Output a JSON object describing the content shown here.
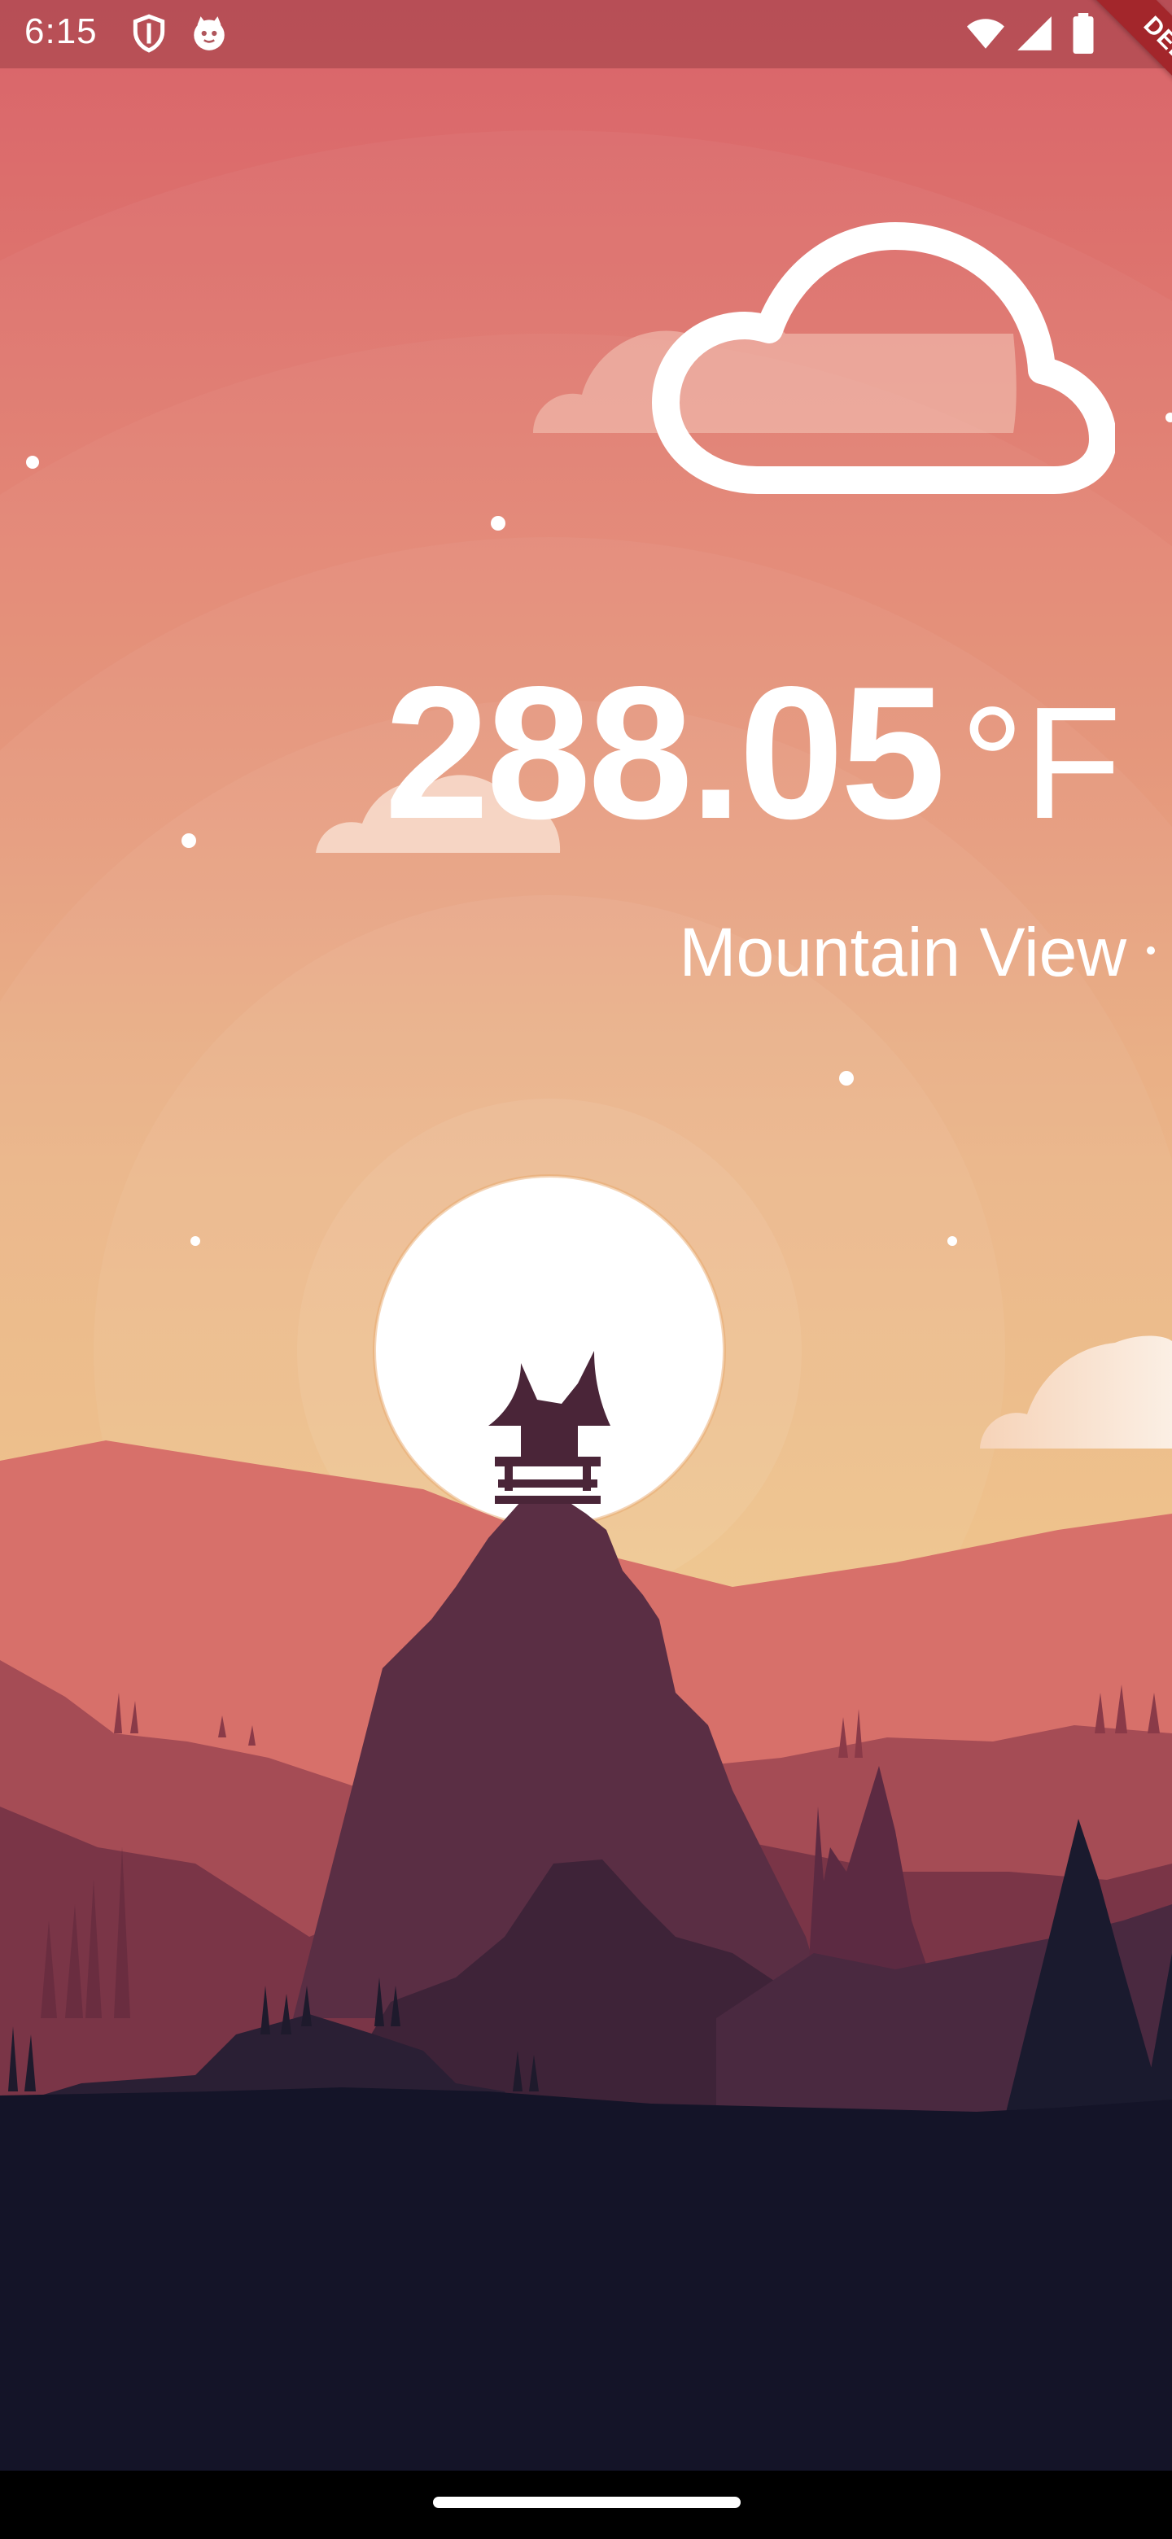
{
  "status_bar": {
    "time": "6:15",
    "icons": [
      "shield-icon",
      "cat-icon",
      "wifi-icon",
      "signal-icon",
      "battery-icon"
    ]
  },
  "debug_banner": {
    "label": "DEBUG"
  },
  "weather": {
    "temperature": "288.05",
    "unit": "°F",
    "city": "Mountain View",
    "condition_icon": "cloud-icon"
  },
  "colors": {
    "sky_top": "#d9656a",
    "sky_bottom": "#ebb678",
    "sun": "#ffffff",
    "ground": "#141428",
    "text": "#ffffff"
  }
}
